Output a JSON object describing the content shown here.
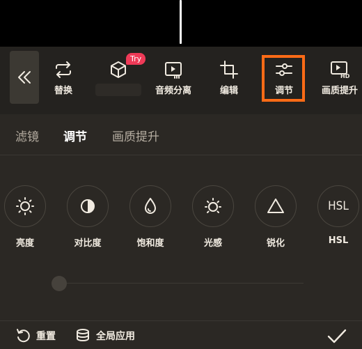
{
  "toolbar": {
    "tools": [
      {
        "label": "替换",
        "icon": "replace-icon"
      },
      {
        "label": "",
        "icon": "3d-cube-icon",
        "badge": "Try"
      },
      {
        "label": "音频分离",
        "icon": "audio-separate-icon"
      },
      {
        "label": "编辑",
        "icon": "crop-icon"
      },
      {
        "label": "调节",
        "icon": "adjust-sliders-icon",
        "highlighted": true
      },
      {
        "label": "画质提升",
        "icon": "hd-enhance-icon"
      }
    ],
    "highlight_color": "#ff6b16"
  },
  "tabs": [
    {
      "label": "滤镜",
      "active": false
    },
    {
      "label": "调节",
      "active": true
    },
    {
      "label": "画质提升",
      "active": false
    }
  ],
  "adjust_items": [
    {
      "label": "亮度",
      "icon": "brightness-icon"
    },
    {
      "label": "对比度",
      "icon": "contrast-icon"
    },
    {
      "label": "饱和度",
      "icon": "saturation-icon"
    },
    {
      "label": "光感",
      "icon": "light-sense-icon"
    },
    {
      "label": "锐化",
      "icon": "sharpen-icon"
    },
    {
      "label": "HSL",
      "icon": "hsl-icon",
      "icon_text": "HSL"
    }
  ],
  "slider": {
    "value": 0
  },
  "bottom": {
    "reset_label": "重置",
    "apply_all_label": "全局应用"
  }
}
